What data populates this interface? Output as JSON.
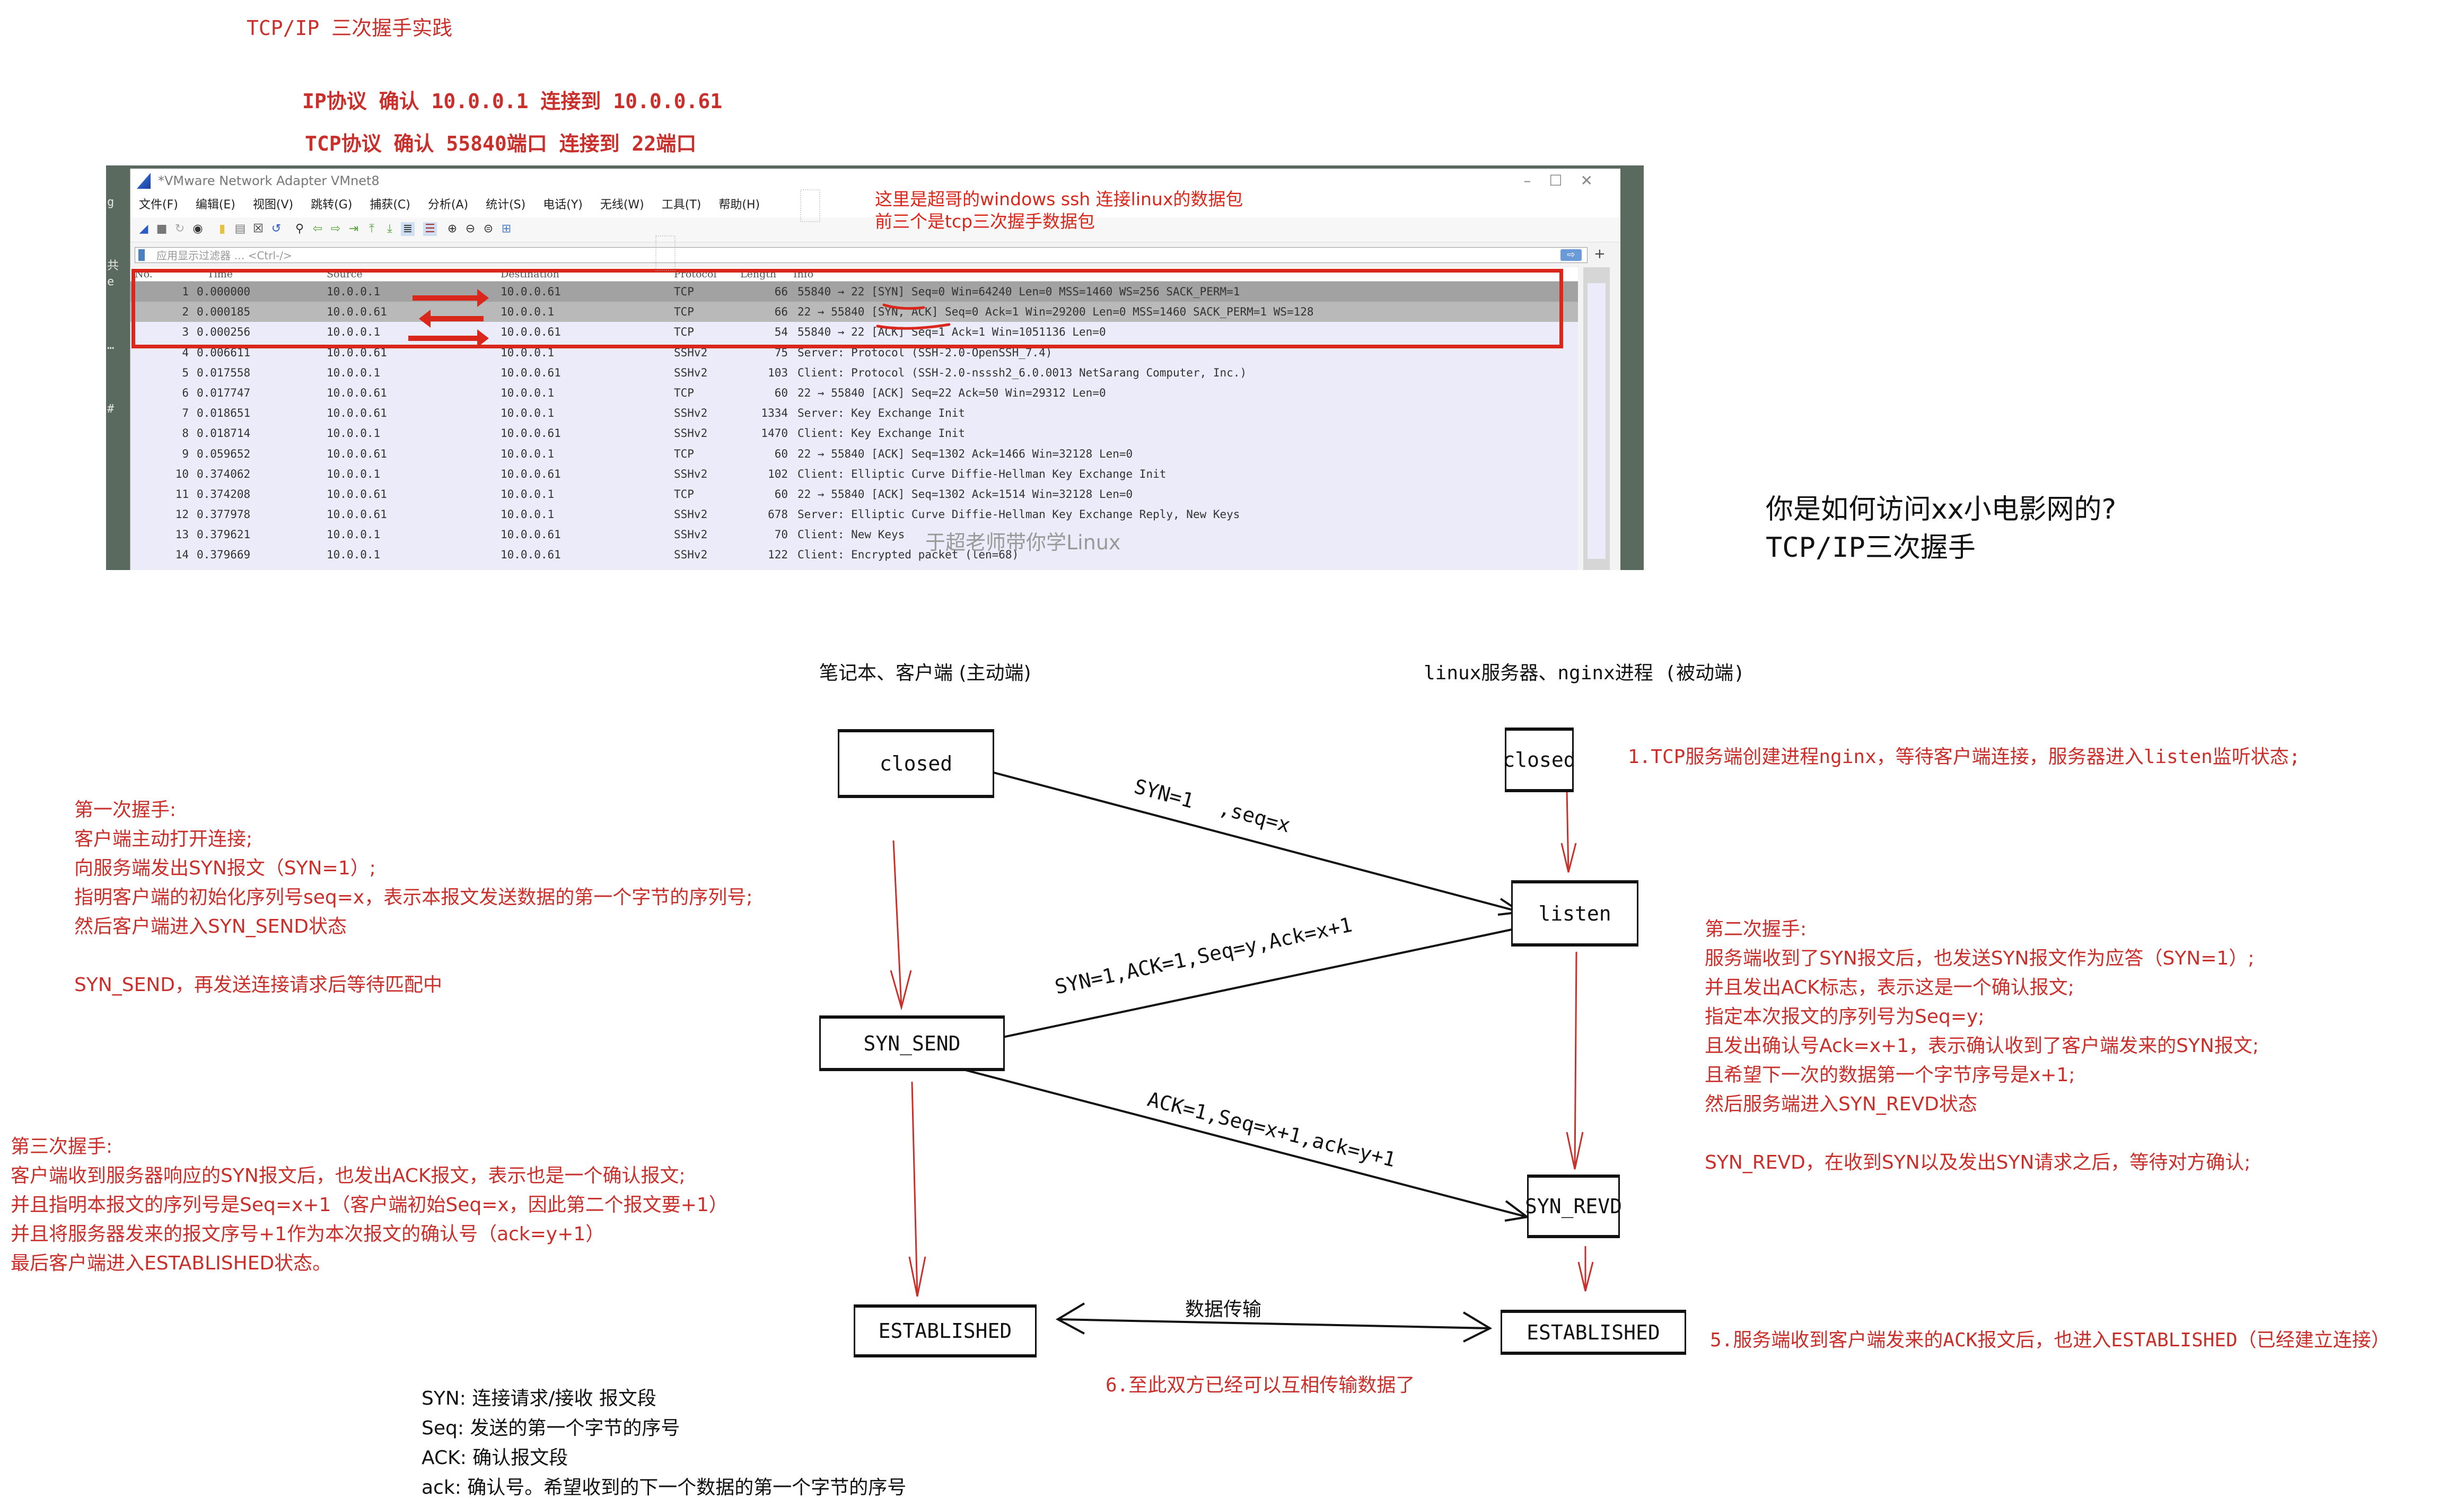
{
  "top": {
    "title": "TCP/IP 三次握手实践",
    "ip_line": "IP协议  确认  10.0.0.1  连接到  10.0.0.61",
    "tcp_line": "TCP协议  确认 55840端口  连接到  22端口"
  },
  "wireshark": {
    "window_title": "*VMware Network Adapter VMnet8",
    "window_buttons": [
      "–",
      "☐",
      "✕"
    ],
    "menu": [
      "文件(F)",
      "编辑(E)",
      "视图(V)",
      "跳转(G)",
      "捕获(C)",
      "分析(A)",
      "统计(S)",
      "电话(Y)",
      "无线(W)",
      "工具(T)",
      "帮助(H)"
    ],
    "toolbar_icons": [
      "shark-fin-start-icon",
      "stop-icon",
      "restart-icon",
      "options-icon",
      "open-folder-icon",
      "file-icon",
      "close-file-icon",
      "reload-icon",
      "find-icon",
      "back-icon",
      "forward-icon",
      "goto-icon",
      "first-icon",
      "last-icon",
      "autoscroll-icon",
      "colorize-icon",
      "zoom-in-icon",
      "zoom-out-icon",
      "zoom-normal-icon",
      "resize-columns-icon"
    ],
    "filter_placeholder": "应用显示过滤器 … <Ctrl-/>",
    "filter_go": "⇨",
    "filter_plus": "+",
    "columns": [
      "No.",
      "Time",
      "Source",
      "Destination",
      "Protocol",
      "Length",
      "Info"
    ],
    "rows": [
      {
        "no": "1",
        "time": "0.000000",
        "src": "10.0.0.1",
        "dst": "10.0.0.61",
        "proto": "TCP",
        "len": "66",
        "info": "55840 → 22 [SYN] Seq=0 Win=64240 Len=0 MSS=1460 WS=256 SACK_PERM=1"
      },
      {
        "no": "2",
        "time": "0.000185",
        "src": "10.0.0.61",
        "dst": "10.0.0.1",
        "proto": "TCP",
        "len": "66",
        "info": "22 → 55840 [SYN, ACK] Seq=0 Ack=1 Win=29200 Len=0 MSS=1460 SACK_PERM=1 WS=128"
      },
      {
        "no": "3",
        "time": "0.000256",
        "src": "10.0.0.1",
        "dst": "10.0.0.61",
        "proto": "TCP",
        "len": "54",
        "info": "55840 → 22 [ACK] Seq=1 Ack=1 Win=1051136 Len=0"
      },
      {
        "no": "4",
        "time": "0.006611",
        "src": "10.0.0.61",
        "dst": "10.0.0.1",
        "proto": "SSHv2",
        "len": "75",
        "info": "Server: Protocol (SSH-2.0-OpenSSH_7.4)"
      },
      {
        "no": "5",
        "time": "0.017558",
        "src": "10.0.0.1",
        "dst": "10.0.0.61",
        "proto": "SSHv2",
        "len": "103",
        "info": "Client: Protocol (SSH-2.0-nsssh2_6.0.0013 NetSarang Computer, Inc.)"
      },
      {
        "no": "6",
        "time": "0.017747",
        "src": "10.0.0.61",
        "dst": "10.0.0.1",
        "proto": "TCP",
        "len": "60",
        "info": "22 → 55840 [ACK] Seq=22 Ack=50 Win=29312 Len=0"
      },
      {
        "no": "7",
        "time": "0.018651",
        "src": "10.0.0.61",
        "dst": "10.0.0.1",
        "proto": "SSHv2",
        "len": "1334",
        "info": "Server: Key Exchange Init"
      },
      {
        "no": "8",
        "time": "0.018714",
        "src": "10.0.0.1",
        "dst": "10.0.0.61",
        "proto": "SSHv2",
        "len": "1470",
        "info": "Client: Key Exchange Init"
      },
      {
        "no": "9",
        "time": "0.059652",
        "src": "10.0.0.61",
        "dst": "10.0.0.1",
        "proto": "TCP",
        "len": "60",
        "info": "22 → 55840 [ACK] Seq=1302 Ack=1466 Win=32128 Len=0"
      },
      {
        "no": "10",
        "time": "0.374062",
        "src": "10.0.0.1",
        "dst": "10.0.0.61",
        "proto": "SSHv2",
        "len": "102",
        "info": "Client: Elliptic Curve Diffie-Hellman Key Exchange Init"
      },
      {
        "no": "11",
        "time": "0.374208",
        "src": "10.0.0.61",
        "dst": "10.0.0.1",
        "proto": "TCP",
        "len": "60",
        "info": "22 → 55840 [ACK] Seq=1302 Ack=1514 Win=32128 Len=0"
      },
      {
        "no": "12",
        "time": "0.377978",
        "src": "10.0.0.61",
        "dst": "10.0.0.1",
        "proto": "SSHv2",
        "len": "678",
        "info": "Server: Elliptic Curve Diffie-Hellman Key Exchange Reply, New Keys"
      },
      {
        "no": "13",
        "time": "0.379621",
        "src": "10.0.0.1",
        "dst": "10.0.0.61",
        "proto": "SSHv2",
        "len": "70",
        "info": "Client: New Keys"
      },
      {
        "no": "14",
        "time": "0.379669",
        "src": "10.0.0.1",
        "dst": "10.0.0.61",
        "proto": "SSHv2",
        "len": "122",
        "info": "Client: Encrypted packet (len=68)"
      }
    ],
    "annotation_line1": "这里是超哥的windows  ssh 连接linux的数据包",
    "annotation_line2": "前三个是tcp三次握手数据包",
    "watermark": "于超老师带你学Linux",
    "left_edge_chars": [
      "g",
      "共",
      "e",
      "…",
      "#"
    ]
  },
  "question": {
    "line1": "你是如何访问xx小电影网的?",
    "line2": "TCP/IP三次握手"
  },
  "diagram": {
    "client_header": "笔记本、客户端  (主动端)",
    "server_header": "linux服务器、nginx进程 (被动端)",
    "states": {
      "client_closed": "closed",
      "server_closed": "closed",
      "listen": "listen",
      "syn_send": "SYN_SEND",
      "syn_revd": "SYN_REVD",
      "client_established": "ESTABLISHED",
      "server_established": "ESTABLISHED"
    },
    "edges": {
      "syn_1": "SYN=1",
      "syn_1_seq": ",seq=x",
      "syn_ack": "SYN=1,ACK=1,Seq=y,Ack=x+1",
      "ack": "ACK=1,Seq=x+1,ack=y+1",
      "data": "数据传输"
    },
    "step1": "1.TCP服务端创建进程nginx，等待客户端连接，服务器进入listen监听状态;",
    "step5": "5.服务端收到客户端发来的ACK报文后，也进入ESTABLISHED（已经建立连接）",
    "step6": "6.至此双方已经可以互相传输数据了",
    "first_handshake": [
      "第一次握手:",
      "客户端主动打开连接;",
      "向服务端发出SYN报文（SYN=1）;",
      "指明客户端的初始化序列号seq=x，表示本报文发送数据的第一个字节的序列号;",
      "然后客户端进入SYN_SEND状态",
      "",
      "SYN_SEND，再发送连接请求后等待匹配中"
    ],
    "second_handshake": [
      "第二次握手:",
      "服务端收到了SYN报文后，也发送SYN报文作为应答（SYN=1）;",
      "并且发出ACK标志，表示这是一个确认报文;",
      "指定本次报文的序列号为Seq=y;",
      "且发出确认号Ack=x+1，表示确认收到了客户端发来的SYN报文;",
      "且希望下一次的数据第一个字节序号是x+1;",
      "然后服务端进入SYN_REVD状态",
      "",
      "SYN_REVD，在收到SYN以及发出SYN请求之后，等待对方确认;"
    ],
    "third_handshake": [
      "第三次握手:",
      "客户端收到服务器响应的SYN报文后，也发出ACK报文，表示也是一个确认报文;",
      "并且指明本报文的序列号是Seq=x+1（客户端初始Seq=x，因此第二个报文要+1）",
      "并且将服务器发来的报文序号+1作为本次报文的确认号（ack=y+1）",
      "最后客户端进入ESTABLISHED状态。"
    ],
    "legend": [
      "SYN: 连接请求/接收  报文段",
      "Seq: 发送的第一个字节的序号",
      "ACK: 确认报文段",
      "ack: 确认号。希望收到的下一个数据的第一个字节的序号"
    ]
  },
  "colors": {
    "annotation_red": "#c9302c",
    "highlight_red": "#d9271c",
    "ink": "#111111",
    "packet_list_bg": "#ebebfa",
    "selected_row": "#a2a2a2"
  }
}
